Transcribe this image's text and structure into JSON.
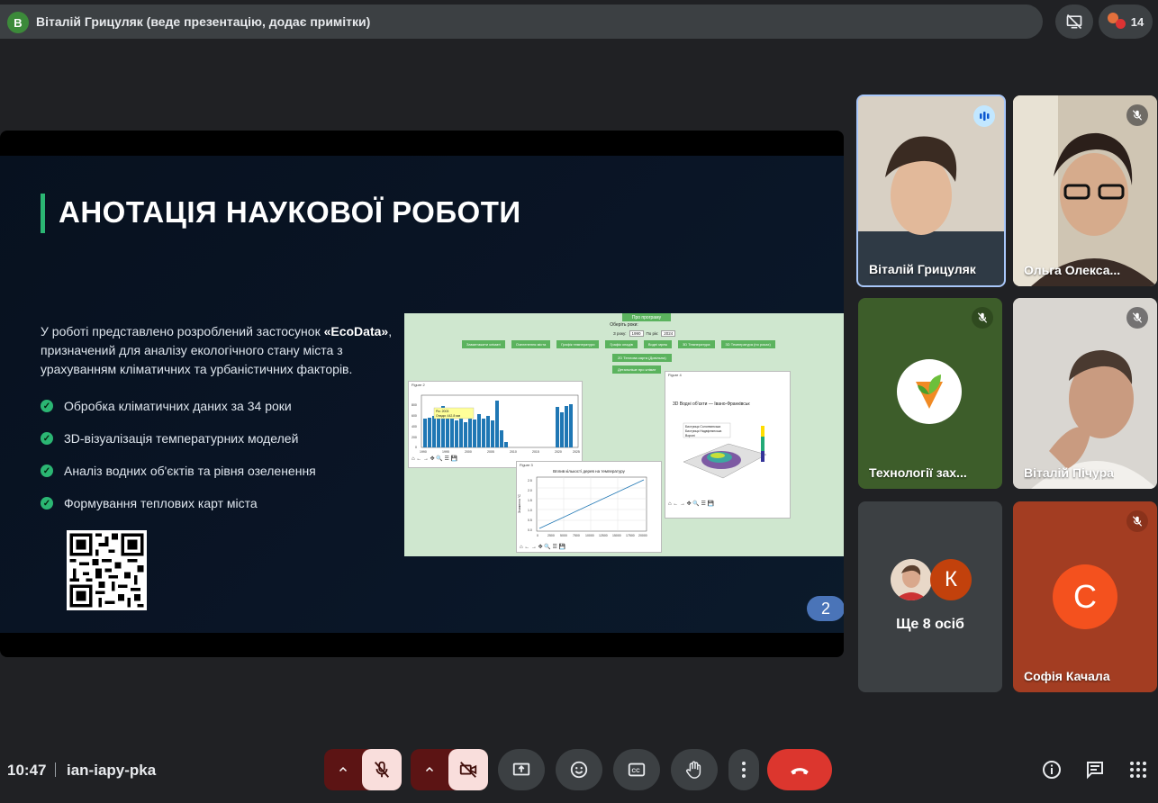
{
  "presenter": {
    "avatar_letter": "В",
    "text": "Віталій Грицуляк (веде презентацію, додає примітки)"
  },
  "participants_count": "14",
  "slide": {
    "title": "АНОТАЦІЯ НАУКОВОЇ РОБОТИ",
    "intro_part1": "У роботі представлено розроблений застосунок ",
    "intro_bold": "«EcoData»",
    "intro_part2": ", призначений для аналізу екологічного стану міста з урахуванням кліматичних та урбаністичних факторів.",
    "bullets": [
      "Обробка кліматичних даних за 34 роки",
      "3D-візуалізація температурних моделей",
      "Аналіз водних об'єктів та рівня озеленення",
      "Формування теплових карт міста"
    ],
    "page_number": "2",
    "app_screenshot": {
      "about_button": "Про програму",
      "period_label": "Оберіть роки:",
      "year_from_label": "З року:",
      "year_from": "1990",
      "year_to_label": "По рік:",
      "year_to": "2024",
      "nav_buttons": [
        "Завантажити кліматі",
        "Озеленення міста",
        "Графік температури",
        "Графік опадів",
        "Водні мреж",
        "3D Температура",
        "3D Температура (по роках)"
      ],
      "heatmap_button": "2D Теплова карта (Довільна)",
      "info_button": "Детальніше про клімат",
      "bar_window": {
        "title": "Figure 2",
        "tooltip_line1": "Рік: 2003",
        "tooltip_line2": "Опади: 442.8 мм",
        "x_ticks": [
          "1990",
          "1995",
          "2000",
          "2005",
          "2010",
          "2015",
          "2020",
          "2025"
        ],
        "y_ticks": [
          "800",
          "600",
          "400",
          "200",
          "0"
        ]
      },
      "line_window": {
        "title": "Figure 3",
        "chart_title": "Вплив кількості дерев на температуру",
        "ylabel": "Зниження °C",
        "y_ticks": [
          "2.5",
          "2.0",
          "1.5",
          "1.0",
          "0.5",
          "0.0"
        ],
        "x_ticks": [
          "0",
          "2500",
          "5000",
          "7500",
          "10000",
          "12500",
          "15000",
          "17500",
          "20000"
        ]
      },
      "surface_window": {
        "title": "Figure 4",
        "chart_title": "3D Водні об'єкти — Івано-Франківськ",
        "legend": [
          "Бистриця Солотвинська",
          "Бистриця Надвірнянська",
          "Вороні"
        ]
      }
    }
  },
  "tiles": [
    {
      "name": "Віталій Грицуляк",
      "state": "speaking",
      "bg": "#c9b9a6"
    },
    {
      "name": "Ольга Олекса...",
      "state": "muted",
      "bg": "#b3a590"
    },
    {
      "name": "Технології зах...",
      "state": "muted",
      "bg": "#3d5d2a"
    },
    {
      "name": "Віталій Пічура",
      "state": "muted",
      "bg": "#8e8a85"
    },
    {
      "name": "Ще 8 осіб",
      "avatar_letter": "К"
    },
    {
      "name": "Софія Качала",
      "avatar_letter": "С",
      "state": "muted",
      "bg": "#a33d22"
    }
  ],
  "bottom": {
    "time": "10:47",
    "meeting_code": "ian-iapy-pka"
  },
  "colors": {
    "accent_green": "#2bb673",
    "end_call": "#dc362e",
    "muted_pill": "#f9dedc",
    "page_badge": "#4a74b8"
  },
  "icons": [
    "screen-share-off-icon",
    "participants-icon",
    "mic-off-icon",
    "camera-off-icon",
    "present-icon",
    "emoji-icon",
    "captions-icon",
    "raise-hand-icon",
    "more-options-icon",
    "end-call-icon",
    "info-icon",
    "chat-icon",
    "activities-icon"
  ]
}
